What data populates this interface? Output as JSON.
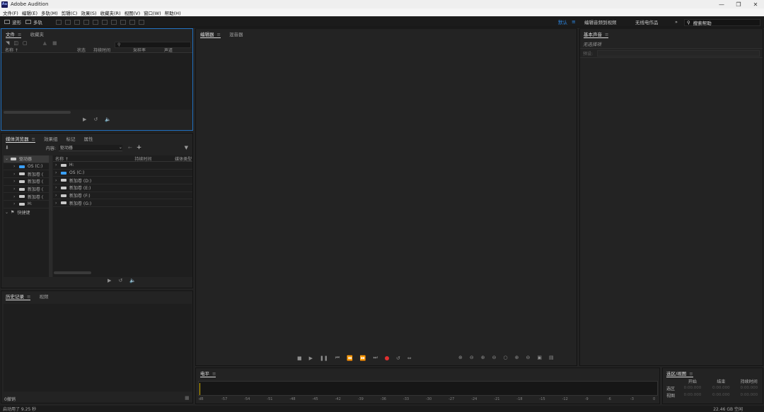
{
  "app": {
    "title": "Adobe Audition",
    "logo": "Au"
  },
  "menu": [
    "文件(F)",
    "编辑(E)",
    "多轨(M)",
    "剪辑(C)",
    "效果(S)",
    "收藏夹(R)",
    "视图(V)",
    "窗口(W)",
    "帮助(H)"
  ],
  "toolbar": {
    "waveform": "波形",
    "multitrack": "多轨"
  },
  "workspaces": {
    "default": "默认",
    "edit_audio_video": "编辑音频到视频",
    "radio": "无线电作品",
    "more": "»"
  },
  "help": {
    "placeholder": "搜索帮助"
  },
  "files_panel": {
    "tabs": [
      "文件",
      "收藏夹"
    ],
    "columns": [
      "名称 ↑",
      "状态",
      "持续时间",
      "采样率",
      "声道"
    ]
  },
  "media_panel": {
    "tabs": [
      "媒体浏览器",
      "效果组",
      "标记",
      "属性"
    ],
    "content_label": "内容:",
    "content_value": "驱动器",
    "tree_root": "驱动器",
    "tree_items": [
      "OS (C:)",
      "新加卷 (",
      "新加卷 (",
      "新加卷 (",
      "新加卷 (",
      "H:"
    ],
    "shortcuts": "快捷键",
    "columns": [
      "名称 ↑",
      "持续时间",
      "媒体类型"
    ],
    "list_items": [
      "H:",
      "OS (C:)",
      "新加卷 (D:)",
      "新加卷 (E:)",
      "新加卷 (F:)",
      "新加卷 (G:)"
    ]
  },
  "history_panel": {
    "tabs": [
      "历史记录",
      "视频"
    ],
    "undo_count": "0撤销"
  },
  "editor_panel": {
    "tabs": [
      "编辑器",
      "混音器"
    ]
  },
  "essential_sound": {
    "title": "基本声音",
    "no_selection": "无选择项",
    "preset_label": "预设:"
  },
  "levels": {
    "title": "电平",
    "ticks": [
      "dB",
      "-57",
      "-54",
      "-51",
      "-48",
      "-45",
      "-42",
      "-39",
      "-36",
      "-33",
      "-30",
      "-27",
      "-24",
      "-21",
      "-18",
      "-15",
      "-12",
      "-9",
      "-6",
      "-3",
      "0"
    ]
  },
  "selection_view": {
    "title": "选区/视图",
    "headers": [
      "开始",
      "结束",
      "持续时间"
    ],
    "selection_label": "选区",
    "view_label": "视图",
    "selection_values": [
      "0:00.000",
      "0:00.000",
      "0:00.000"
    ],
    "view_values": [
      "0:00.000",
      "0:00.000",
      "0:00.000"
    ]
  },
  "status": {
    "startup": "启动用了 9.25 秒",
    "disk_free": "22.46 GB 空闲"
  },
  "colors": {
    "accent": "#2d8ceb",
    "record": "#e03030",
    "panel_focus": "#1f6fc0"
  }
}
